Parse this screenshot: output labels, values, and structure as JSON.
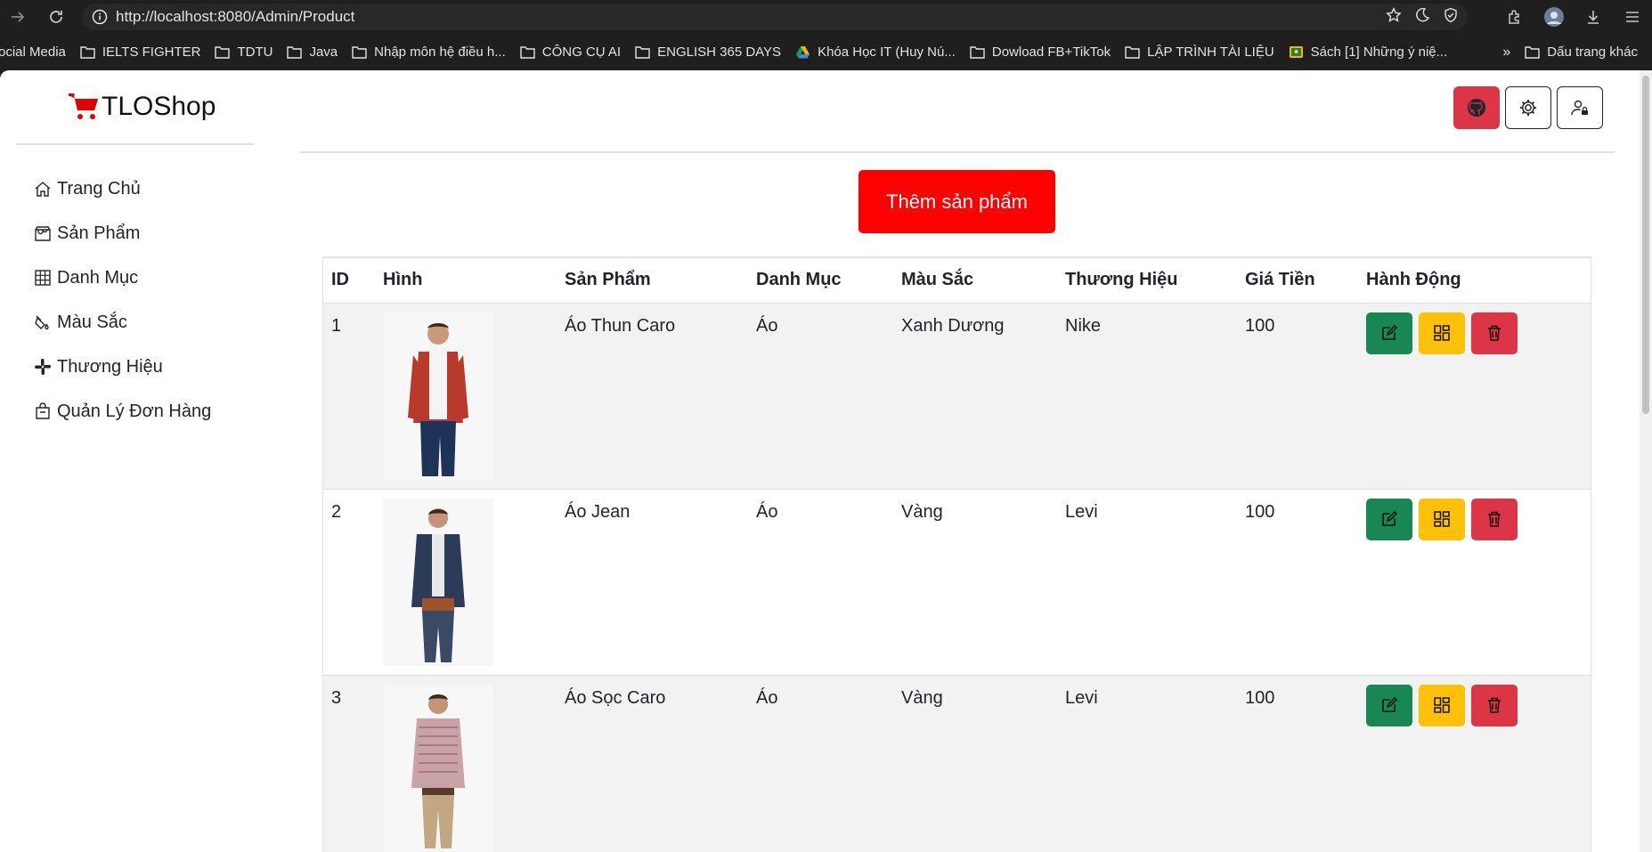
{
  "browser": {
    "url": "http://localhost:8080/Admin/Product",
    "bookmarks": [
      "ocial Media",
      "IELTS FIGHTER",
      "TDTU",
      "Java",
      "Nhập môn hệ điều h...",
      "CÔNG CỤ AI",
      "ENGLISH 365 DAYS",
      "Khóa Học IT (Huy Nú...",
      "Dowload FB+TikTok",
      "LẬP TRÌNH TÀI LIỆU",
      "Sách [1] Những ý niệ..."
    ],
    "more_label": "»",
    "other_bookmarks": "Dấu trang khác"
  },
  "brand": {
    "name": "TLOShop"
  },
  "sidebar": {
    "items": [
      {
        "label": "Trang Chủ",
        "icon": "house-icon"
      },
      {
        "label": "Sản Phẩm",
        "icon": "shop-icon"
      },
      {
        "label": "Danh Mục",
        "icon": "grid-icon"
      },
      {
        "label": "Màu Sắc",
        "icon": "paint-bucket-icon"
      },
      {
        "label": "Thương Hiệu",
        "icon": "slack-icon"
      },
      {
        "label": "Quản Lý Đơn Hàng",
        "icon": "bag-icon"
      }
    ]
  },
  "main": {
    "add_button": "Thêm sản phẩm",
    "table": {
      "headers": [
        "ID",
        "Hình",
        "Sản Phẩm",
        "Danh Mục",
        "Màu Sắc",
        "Thương Hiệu",
        "Giá Tiền",
        "Hành Động"
      ],
      "rows": [
        {
          "id": "1",
          "name": "Áo Thun Caro",
          "category": "Áo",
          "color": "Xanh Dương",
          "brand": "Nike",
          "price": "100"
        },
        {
          "id": "2",
          "name": "Áo Jean",
          "category": "Áo",
          "color": "Vàng",
          "brand": "Levi",
          "price": "100"
        },
        {
          "id": "3",
          "name": "Áo Sọc Caro",
          "category": "Áo",
          "color": "Vàng",
          "brand": "Levi",
          "price": "100"
        }
      ]
    }
  },
  "colors": {
    "accent_red": "#ff0000",
    "edit_green": "#198754",
    "detail_yellow": "#ffc107",
    "delete_red": "#dc3545"
  }
}
